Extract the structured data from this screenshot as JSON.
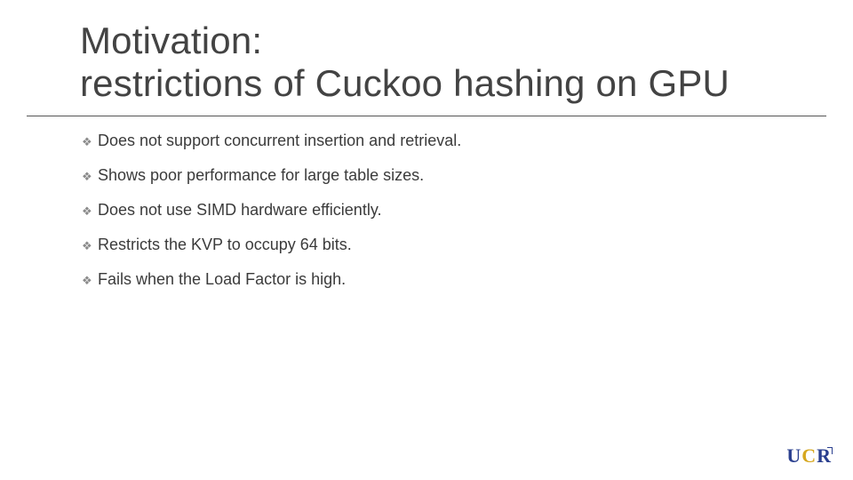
{
  "title": {
    "line1": "Motivation:",
    "line2": "restrictions of Cuckoo hashing on GPU"
  },
  "bullets": [
    "Does not support concurrent insertion and retrieval.",
    "Shows poor performance for large table sizes.",
    "Does not use SIMD hardware efficiently.",
    "Restricts the KVP to occupy 64 bits.",
    "Fails when the Load Factor is high."
  ],
  "logo": {
    "u": "U",
    "c": "C",
    "r": "R"
  }
}
